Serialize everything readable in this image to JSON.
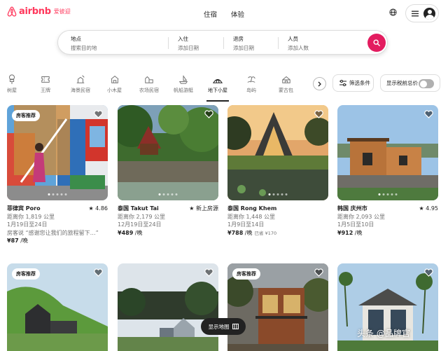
{
  "header": {
    "brand": "airbnb",
    "brand_sub": "爱彼迎",
    "nav": [
      "住宿",
      "体验"
    ],
    "brand_color": "#ff385c"
  },
  "search": {
    "location": {
      "label": "地点",
      "placeholder": "搜索目的地"
    },
    "checkin": {
      "label": "入住",
      "placeholder": "添加日期"
    },
    "checkout": {
      "label": "退房",
      "placeholder": "添加日期"
    },
    "guests": {
      "label": "人员",
      "placeholder": "添加人数"
    },
    "button_color": "#e31c5f"
  },
  "categories": [
    {
      "label": "树屋",
      "icon": "treehouse-icon"
    },
    {
      "label": "王牌",
      "icon": "ticket-icon"
    },
    {
      "label": "海景民宿",
      "icon": "beach-house-icon"
    },
    {
      "label": "小木屋",
      "icon": "cabin-icon"
    },
    {
      "label": "农场民宿",
      "icon": "farm-icon"
    },
    {
      "label": "帆船游艇",
      "icon": "boat-icon"
    },
    {
      "label": "地下小屋",
      "icon": "earth-home-icon",
      "active": true
    },
    {
      "label": "岛屿",
      "icon": "island-icon"
    },
    {
      "label": "蒙古包",
      "icon": "yurt-icon"
    }
  ],
  "filters": {
    "label": "筛选条件",
    "price_toggle": "显示税前总价",
    "price_toggle_on": false
  },
  "listings": [
    {
      "badge": "房客推荐",
      "title": "菲律宾 Poro",
      "rating": "★ 4.86",
      "distance": "距离你 1,819 公里",
      "dates": "1月19日至24日",
      "extra": "房客说 “感谢您让我们的旅程留下…”",
      "price": "¥87",
      "unit": " /晚",
      "old": ""
    },
    {
      "badge": "",
      "title": "泰国 Takut Tai",
      "rating": "★ 新上房源",
      "distance": "距离你 2,179 公里",
      "dates": "12月19日至24日",
      "extra": "",
      "price": "¥489",
      "unit": " /晚",
      "old": ""
    },
    {
      "badge": "",
      "title": "泰国 Rong Khem",
      "rating": "",
      "distance": "距离你 1,448 公里",
      "dates": "1月9日至14日",
      "extra": "",
      "price": "¥788",
      "unit": " /晚",
      "old": "已省 ¥170"
    },
    {
      "badge": "",
      "title": "韩国 庆州市",
      "rating": "★ 4.95",
      "distance": "距离你 2,093 公里",
      "dates": "1月5日至10日",
      "extra": "",
      "price": "¥912",
      "unit": " /晚",
      "old": ""
    },
    {
      "badge": "房客推荐"
    },
    {
      "badge": ""
    },
    {
      "badge": "房客推荐"
    },
    {
      "badge": ""
    }
  ],
  "map_button": "显示地图",
  "watermark": "头条 @品牌官"
}
